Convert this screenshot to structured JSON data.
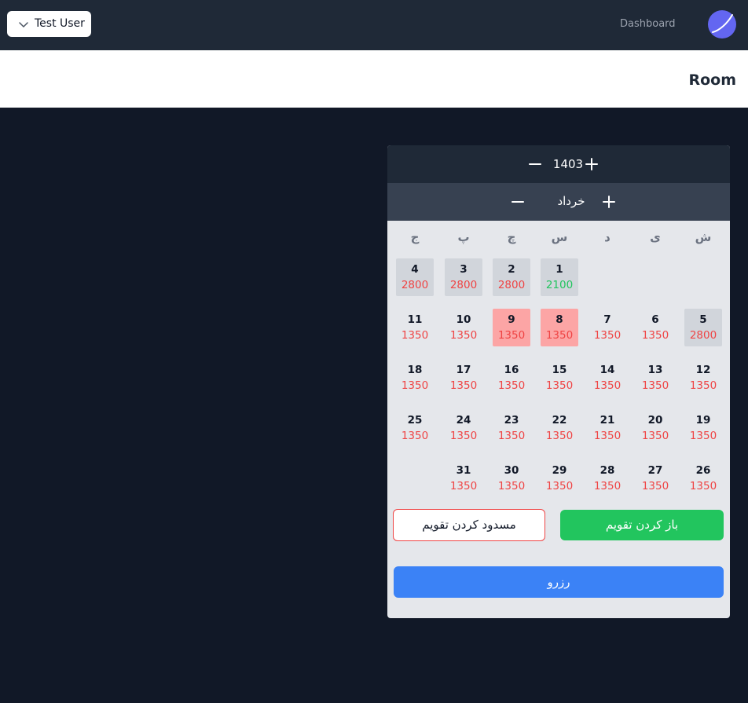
{
  "navbar": {
    "user_name": "Test User",
    "nav_link": "Dashboard"
  },
  "header": {
    "title": "Room"
  },
  "calendar": {
    "year": "1403",
    "month": "خرداد",
    "weekdays": [
      "ش",
      "ی",
      "د",
      "س",
      "چ",
      "پ",
      "ج"
    ],
    "days": [
      {
        "day": "1",
        "price": "2100",
        "state": "gray",
        "price_color": "green"
      },
      {
        "day": "2",
        "price": "2800",
        "state": "gray"
      },
      {
        "day": "3",
        "price": "2800",
        "state": "gray"
      },
      {
        "day": "4",
        "price": "2800",
        "state": "gray"
      },
      {
        "day": "5",
        "price": "2800",
        "state": "gray"
      },
      {
        "day": "6",
        "price": "1350"
      },
      {
        "day": "7",
        "price": "1350"
      },
      {
        "day": "8",
        "price": "1350",
        "state": "red"
      },
      {
        "day": "9",
        "price": "1350",
        "state": "red"
      },
      {
        "day": "10",
        "price": "1350"
      },
      {
        "day": "11",
        "price": "1350"
      },
      {
        "day": "12",
        "price": "1350"
      },
      {
        "day": "13",
        "price": "1350"
      },
      {
        "day": "14",
        "price": "1350"
      },
      {
        "day": "15",
        "price": "1350"
      },
      {
        "day": "16",
        "price": "1350"
      },
      {
        "day": "17",
        "price": "1350"
      },
      {
        "day": "18",
        "price": "1350"
      },
      {
        "day": "19",
        "price": "1350"
      },
      {
        "day": "20",
        "price": "1350"
      },
      {
        "day": "21",
        "price": "1350"
      },
      {
        "day": "22",
        "price": "1350"
      },
      {
        "day": "23",
        "price": "1350"
      },
      {
        "day": "24",
        "price": "1350"
      },
      {
        "day": "25",
        "price": "1350"
      },
      {
        "day": "26",
        "price": "1350"
      },
      {
        "day": "27",
        "price": "1350"
      },
      {
        "day": "28",
        "price": "1350"
      },
      {
        "day": "29",
        "price": "1350"
      },
      {
        "day": "30",
        "price": "1350"
      },
      {
        "day": "31",
        "price": "1350"
      }
    ],
    "block_label": "مسدود کردن تقویم",
    "open_label": "باز کردن تقویم",
    "reserve_label": "رزرو"
  },
  "colors": {
    "navbar_bg": "#1f2937",
    "page_bg": "#111827",
    "panel_bg": "#e5e7eb",
    "reserved_day": "#fca5a5",
    "past_day": "#d1d5db",
    "price_red": "#ef4444",
    "price_green": "#22c55e",
    "open_button": "#22c55e",
    "reserve_button": "#3b82f6",
    "logo": "#6366f1"
  },
  "icons": {
    "user_menu": "chevron-down-icon",
    "logo": "logo-icon",
    "decrement": "minus-icon",
    "increment": "plus-icon"
  }
}
